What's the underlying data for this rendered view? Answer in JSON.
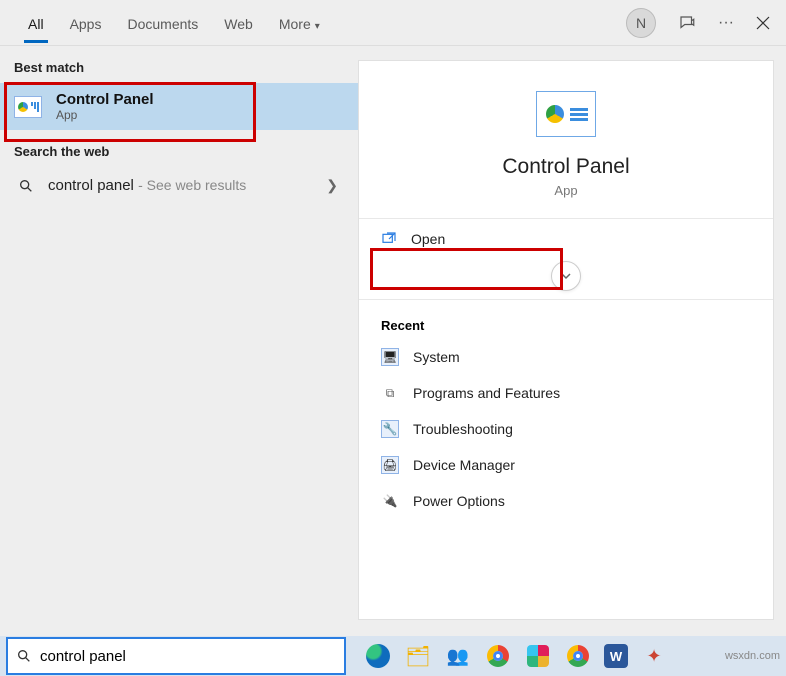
{
  "header": {
    "tabs": [
      "All",
      "Apps",
      "Documents",
      "Web",
      "More"
    ],
    "avatar_initial": "N"
  },
  "left": {
    "best_match_label": "Best match",
    "result": {
      "title": "Control Panel",
      "subtitle": "App"
    },
    "search_web_label": "Search the web",
    "web_query": "control panel",
    "web_hint": "See web results"
  },
  "detail": {
    "title": "Control Panel",
    "subtitle": "App",
    "open_label": "Open",
    "recent_label": "Recent",
    "recent": [
      {
        "label": "System"
      },
      {
        "label": "Programs and Features"
      },
      {
        "label": "Troubleshooting"
      },
      {
        "label": "Device Manager"
      },
      {
        "label": "Power Options"
      }
    ]
  },
  "taskbar": {
    "search_value": "control panel",
    "icons": [
      "edge",
      "explorer",
      "teams",
      "chrome",
      "slack",
      "chrome2",
      "word",
      "pixlr"
    ]
  },
  "watermark": "wsxdn.com"
}
